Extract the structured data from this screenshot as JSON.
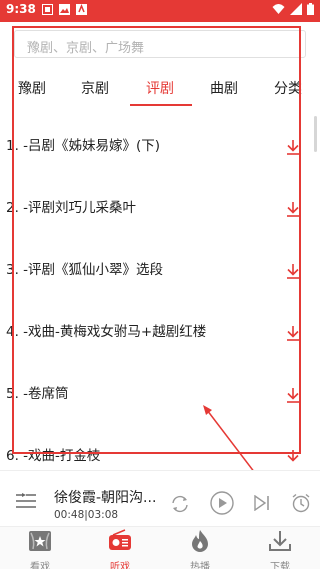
{
  "status_bar": {
    "time": "9:38"
  },
  "search": {
    "placeholder": "豫剧、京剧、广场舞"
  },
  "tabs": [
    {
      "label": "豫剧",
      "active": false
    },
    {
      "label": "京剧",
      "active": false
    },
    {
      "label": "评剧",
      "active": true
    },
    {
      "label": "曲剧",
      "active": false
    },
    {
      "label": "分类",
      "active": false
    }
  ],
  "list": {
    "items": [
      {
        "title": "1. -吕剧《姊妹易嫁》(下)"
      },
      {
        "title": "2. -评剧刘巧儿采桑叶"
      },
      {
        "title": "3. -评剧《狐仙小翠》选段"
      },
      {
        "title": "4. -戏曲-黄梅戏女驸马+越剧红楼"
      },
      {
        "title": "5. -卷席筒"
      },
      {
        "title": "6. -戏曲-打金枝"
      }
    ],
    "download_icon": "download-arrow-icon"
  },
  "player": {
    "song": "徐俊霞-朝阳沟...",
    "time": "00:48|03:08",
    "icons": [
      "playlist-icon",
      "repeat-icon",
      "play-icon",
      "next-icon",
      "timer-icon"
    ]
  },
  "nav": {
    "items": [
      {
        "label": "看戏",
        "icon": "theater-icon",
        "active": false
      },
      {
        "label": "听戏",
        "icon": "radio-icon",
        "active": true
      },
      {
        "label": "热播",
        "icon": "flame-icon",
        "active": false
      },
      {
        "label": "下载",
        "icon": "download-icon",
        "active": false
      }
    ]
  },
  "colors": {
    "accent": "#e53935",
    "text": "#222222",
    "muted": "#888888"
  }
}
